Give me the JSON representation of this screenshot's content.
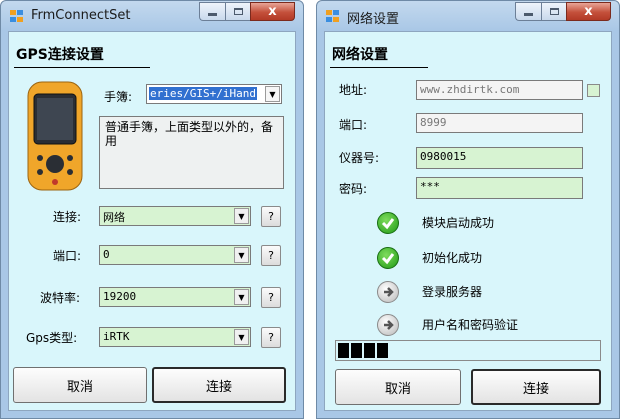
{
  "connect_window": {
    "title": "FrmConnectSet",
    "section_title": "GPS连接设置",
    "handbook_label": "手簿:",
    "handbook_value": "eries/GIS+/iHand",
    "description": "普通手簿，上面类型以外的，备用",
    "connection_label": "连接:",
    "connection_value": "网络",
    "port_label": "端口:",
    "port_value": "0",
    "baud_label": "波特率:",
    "baud_value": "19200",
    "gps_type_label": "Gps类型:",
    "gps_type_value": "iRTK",
    "help_label": "?",
    "cancel_label": "取消",
    "connect_label": "连接"
  },
  "network_window": {
    "title": "网络设置",
    "section_title": "网络设置",
    "address_label": "地址:",
    "address_value": "www.zhdirtk.com",
    "port_label": "端口:",
    "port_value": "8999",
    "instrument_label": "仪器号:",
    "instrument_value": "0980015",
    "password_label": "密码:",
    "password_value": "***",
    "statuses": [
      {
        "label": "模块启动成功",
        "state": "ok"
      },
      {
        "label": "初始化成功",
        "state": "ok"
      },
      {
        "label": "登录服务器",
        "state": "pending"
      },
      {
        "label": "用户名和密码验证",
        "state": "pending"
      }
    ],
    "progress_blocks": 4,
    "cancel_label": "取消",
    "connect_label": "连接"
  },
  "caption_buttons": {
    "close_label": "x"
  },
  "colors": {
    "client_bg": "#d9f6fb",
    "field_green": "#d7f3d2",
    "frame": "#a9c7e6",
    "close_red": "#c4503b"
  }
}
